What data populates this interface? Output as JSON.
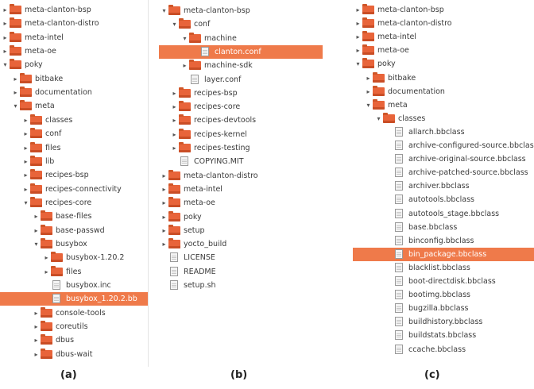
{
  "panels": [
    {
      "id": "a",
      "caption": "(a)",
      "rows": [
        {
          "label": "meta-clanton-bsp",
          "depth": 0,
          "expander": "collapsed",
          "icon": "folder"
        },
        {
          "label": "meta-clanton-distro",
          "depth": 0,
          "expander": "collapsed",
          "icon": "folder"
        },
        {
          "label": "meta-intel",
          "depth": 0,
          "expander": "collapsed",
          "icon": "folder"
        },
        {
          "label": "meta-oe",
          "depth": 0,
          "expander": "collapsed",
          "icon": "folder"
        },
        {
          "label": "poky",
          "depth": 0,
          "expander": "expanded",
          "icon": "folder"
        },
        {
          "label": "bitbake",
          "depth": 1,
          "expander": "collapsed",
          "icon": "folder"
        },
        {
          "label": "documentation",
          "depth": 1,
          "expander": "collapsed",
          "icon": "folder"
        },
        {
          "label": "meta",
          "depth": 1,
          "expander": "expanded",
          "icon": "folder"
        },
        {
          "label": "classes",
          "depth": 2,
          "expander": "collapsed",
          "icon": "folder"
        },
        {
          "label": "conf",
          "depth": 2,
          "expander": "collapsed",
          "icon": "folder"
        },
        {
          "label": "files",
          "depth": 2,
          "expander": "collapsed",
          "icon": "folder"
        },
        {
          "label": "lib",
          "depth": 2,
          "expander": "collapsed",
          "icon": "folder"
        },
        {
          "label": "recipes-bsp",
          "depth": 2,
          "expander": "collapsed",
          "icon": "folder"
        },
        {
          "label": "recipes-connectivity",
          "depth": 2,
          "expander": "collapsed",
          "icon": "folder"
        },
        {
          "label": "recipes-core",
          "depth": 2,
          "expander": "expanded",
          "icon": "folder"
        },
        {
          "label": "base-files",
          "depth": 3,
          "expander": "collapsed",
          "icon": "folder"
        },
        {
          "label": "base-passwd",
          "depth": 3,
          "expander": "collapsed",
          "icon": "folder"
        },
        {
          "label": "busybox",
          "depth": 3,
          "expander": "expanded",
          "icon": "folder"
        },
        {
          "label": "busybox-1.20.2",
          "depth": 4,
          "expander": "collapsed",
          "icon": "folder"
        },
        {
          "label": "files",
          "depth": 4,
          "expander": "collapsed",
          "icon": "folder"
        },
        {
          "label": "busybox.inc",
          "depth": 4,
          "expander": "none",
          "icon": "file"
        },
        {
          "label": "busybox_1.20.2.bb",
          "depth": 4,
          "expander": "none",
          "icon": "file",
          "selected": true
        },
        {
          "label": "console-tools",
          "depth": 3,
          "expander": "collapsed",
          "icon": "folder"
        },
        {
          "label": "coreutils",
          "depth": 3,
          "expander": "collapsed",
          "icon": "folder"
        },
        {
          "label": "dbus",
          "depth": 3,
          "expander": "collapsed",
          "icon": "folder"
        },
        {
          "label": "dbus-wait",
          "depth": 3,
          "expander": "collapsed",
          "icon": "folder"
        }
      ]
    },
    {
      "id": "b",
      "caption": "(b)",
      "rows": [
        {
          "label": "meta-clanton-bsp",
          "depth": 0,
          "expander": "expanded",
          "icon": "folder"
        },
        {
          "label": "conf",
          "depth": 1,
          "expander": "expanded",
          "icon": "folder"
        },
        {
          "label": "machine",
          "depth": 2,
          "expander": "expanded",
          "icon": "folder"
        },
        {
          "label": "clanton.conf",
          "depth": 3,
          "expander": "none",
          "icon": "file",
          "selected": true
        },
        {
          "label": "machine-sdk",
          "depth": 2,
          "expander": "collapsed",
          "icon": "folder"
        },
        {
          "label": "layer.conf",
          "depth": 2,
          "expander": "none",
          "icon": "file"
        },
        {
          "label": "recipes-bsp",
          "depth": 1,
          "expander": "collapsed",
          "icon": "folder"
        },
        {
          "label": "recipes-core",
          "depth": 1,
          "expander": "collapsed",
          "icon": "folder"
        },
        {
          "label": "recipes-devtools",
          "depth": 1,
          "expander": "collapsed",
          "icon": "folder"
        },
        {
          "label": "recipes-kernel",
          "depth": 1,
          "expander": "collapsed",
          "icon": "folder"
        },
        {
          "label": "recipes-testing",
          "depth": 1,
          "expander": "collapsed",
          "icon": "folder"
        },
        {
          "label": "COPYING.MIT",
          "depth": 1,
          "expander": "none",
          "icon": "file"
        },
        {
          "label": "meta-clanton-distro",
          "depth": 0,
          "expander": "collapsed",
          "icon": "folder"
        },
        {
          "label": "meta-intel",
          "depth": 0,
          "expander": "collapsed",
          "icon": "folder"
        },
        {
          "label": "meta-oe",
          "depth": 0,
          "expander": "collapsed",
          "icon": "folder"
        },
        {
          "label": "poky",
          "depth": 0,
          "expander": "collapsed",
          "icon": "folder"
        },
        {
          "label": "setup",
          "depth": 0,
          "expander": "collapsed",
          "icon": "folder"
        },
        {
          "label": "yocto_build",
          "depth": 0,
          "expander": "collapsed",
          "icon": "folder"
        },
        {
          "label": "LICENSE",
          "depth": 0,
          "expander": "none",
          "icon": "file"
        },
        {
          "label": "README",
          "depth": 0,
          "expander": "none",
          "icon": "file"
        },
        {
          "label": "setup.sh",
          "depth": 0,
          "expander": "none",
          "icon": "file"
        }
      ]
    },
    {
      "id": "c",
      "caption": "(c)",
      "rows": [
        {
          "label": "meta-clanton-bsp",
          "depth": 0,
          "expander": "collapsed",
          "icon": "folder"
        },
        {
          "label": "meta-clanton-distro",
          "depth": 0,
          "expander": "collapsed",
          "icon": "folder"
        },
        {
          "label": "meta-intel",
          "depth": 0,
          "expander": "collapsed",
          "icon": "folder"
        },
        {
          "label": "meta-oe",
          "depth": 0,
          "expander": "collapsed",
          "icon": "folder"
        },
        {
          "label": "poky",
          "depth": 0,
          "expander": "expanded",
          "icon": "folder"
        },
        {
          "label": "bitbake",
          "depth": 1,
          "expander": "collapsed",
          "icon": "folder"
        },
        {
          "label": "documentation",
          "depth": 1,
          "expander": "collapsed",
          "icon": "folder"
        },
        {
          "label": "meta",
          "depth": 1,
          "expander": "expanded",
          "icon": "folder"
        },
        {
          "label": "classes",
          "depth": 2,
          "expander": "expanded",
          "icon": "folder"
        },
        {
          "label": "allarch.bbclass",
          "depth": 3,
          "expander": "none",
          "icon": "file"
        },
        {
          "label": "archive-configured-source.bbclass",
          "depth": 3,
          "expander": "none",
          "icon": "file"
        },
        {
          "label": "archive-original-source.bbclass",
          "depth": 3,
          "expander": "none",
          "icon": "file"
        },
        {
          "label": "archive-patched-source.bbclass",
          "depth": 3,
          "expander": "none",
          "icon": "file"
        },
        {
          "label": "archiver.bbclass",
          "depth": 3,
          "expander": "none",
          "icon": "file"
        },
        {
          "label": "autotools.bbclass",
          "depth": 3,
          "expander": "none",
          "icon": "file"
        },
        {
          "label": "autotools_stage.bbclass",
          "depth": 3,
          "expander": "none",
          "icon": "file"
        },
        {
          "label": "base.bbclass",
          "depth": 3,
          "expander": "none",
          "icon": "file"
        },
        {
          "label": "binconfig.bbclass",
          "depth": 3,
          "expander": "none",
          "icon": "file"
        },
        {
          "label": "bin_package.bbclass",
          "depth": 3,
          "expander": "none",
          "icon": "file",
          "selected": true
        },
        {
          "label": "blacklist.bbclass",
          "depth": 3,
          "expander": "none",
          "icon": "file"
        },
        {
          "label": "boot-directdisk.bbclass",
          "depth": 3,
          "expander": "none",
          "icon": "file"
        },
        {
          "label": "bootimg.bbclass",
          "depth": 3,
          "expander": "none",
          "icon": "file"
        },
        {
          "label": "bugzilla.bbclass",
          "depth": 3,
          "expander": "none",
          "icon": "file"
        },
        {
          "label": "buildhistory.bbclass",
          "depth": 3,
          "expander": "none",
          "icon": "file"
        },
        {
          "label": "buildstats.bbclass",
          "depth": 3,
          "expander": "none",
          "icon": "file"
        },
        {
          "label": "ccache.bbclass",
          "depth": 3,
          "expander": "none",
          "icon": "file"
        }
      ]
    }
  ]
}
